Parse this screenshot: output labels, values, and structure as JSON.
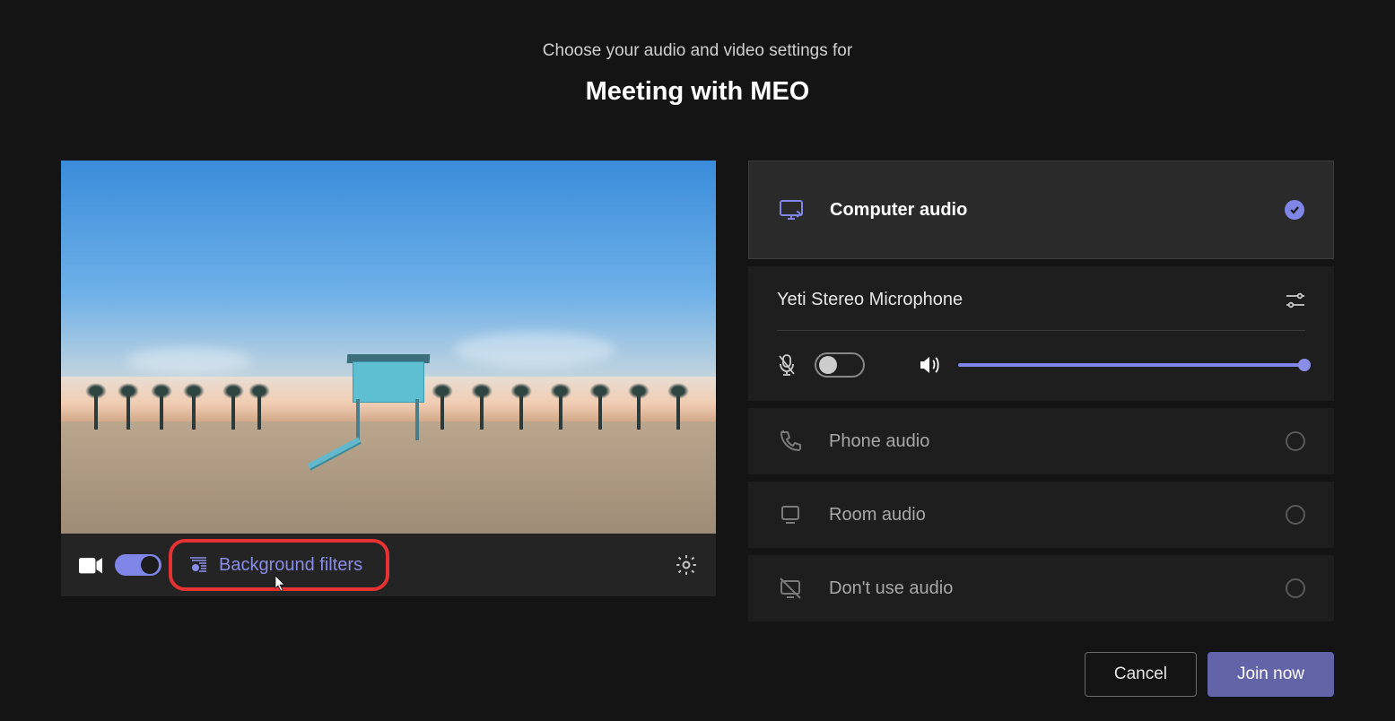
{
  "header": {
    "subtitle": "Choose your audio and video settings for",
    "title": "Meeting with MEO"
  },
  "video": {
    "camera_on": true,
    "background_filters_label": "Background filters"
  },
  "audio": {
    "options": [
      {
        "id": "computer",
        "label": "Computer audio",
        "selected": true
      },
      {
        "id": "phone",
        "label": "Phone audio",
        "selected": false
      },
      {
        "id": "room",
        "label": "Room audio",
        "selected": false
      },
      {
        "id": "none",
        "label": "Don't use audio",
        "selected": false
      }
    ],
    "device": {
      "name": "Yeti Stereo Microphone",
      "mic_muted": true,
      "mic_toggle_on": false,
      "volume": 100
    }
  },
  "footer": {
    "cancel_label": "Cancel",
    "join_label": "Join now"
  },
  "colors": {
    "accent": "#8085e8",
    "highlight_border": "#e53232"
  }
}
